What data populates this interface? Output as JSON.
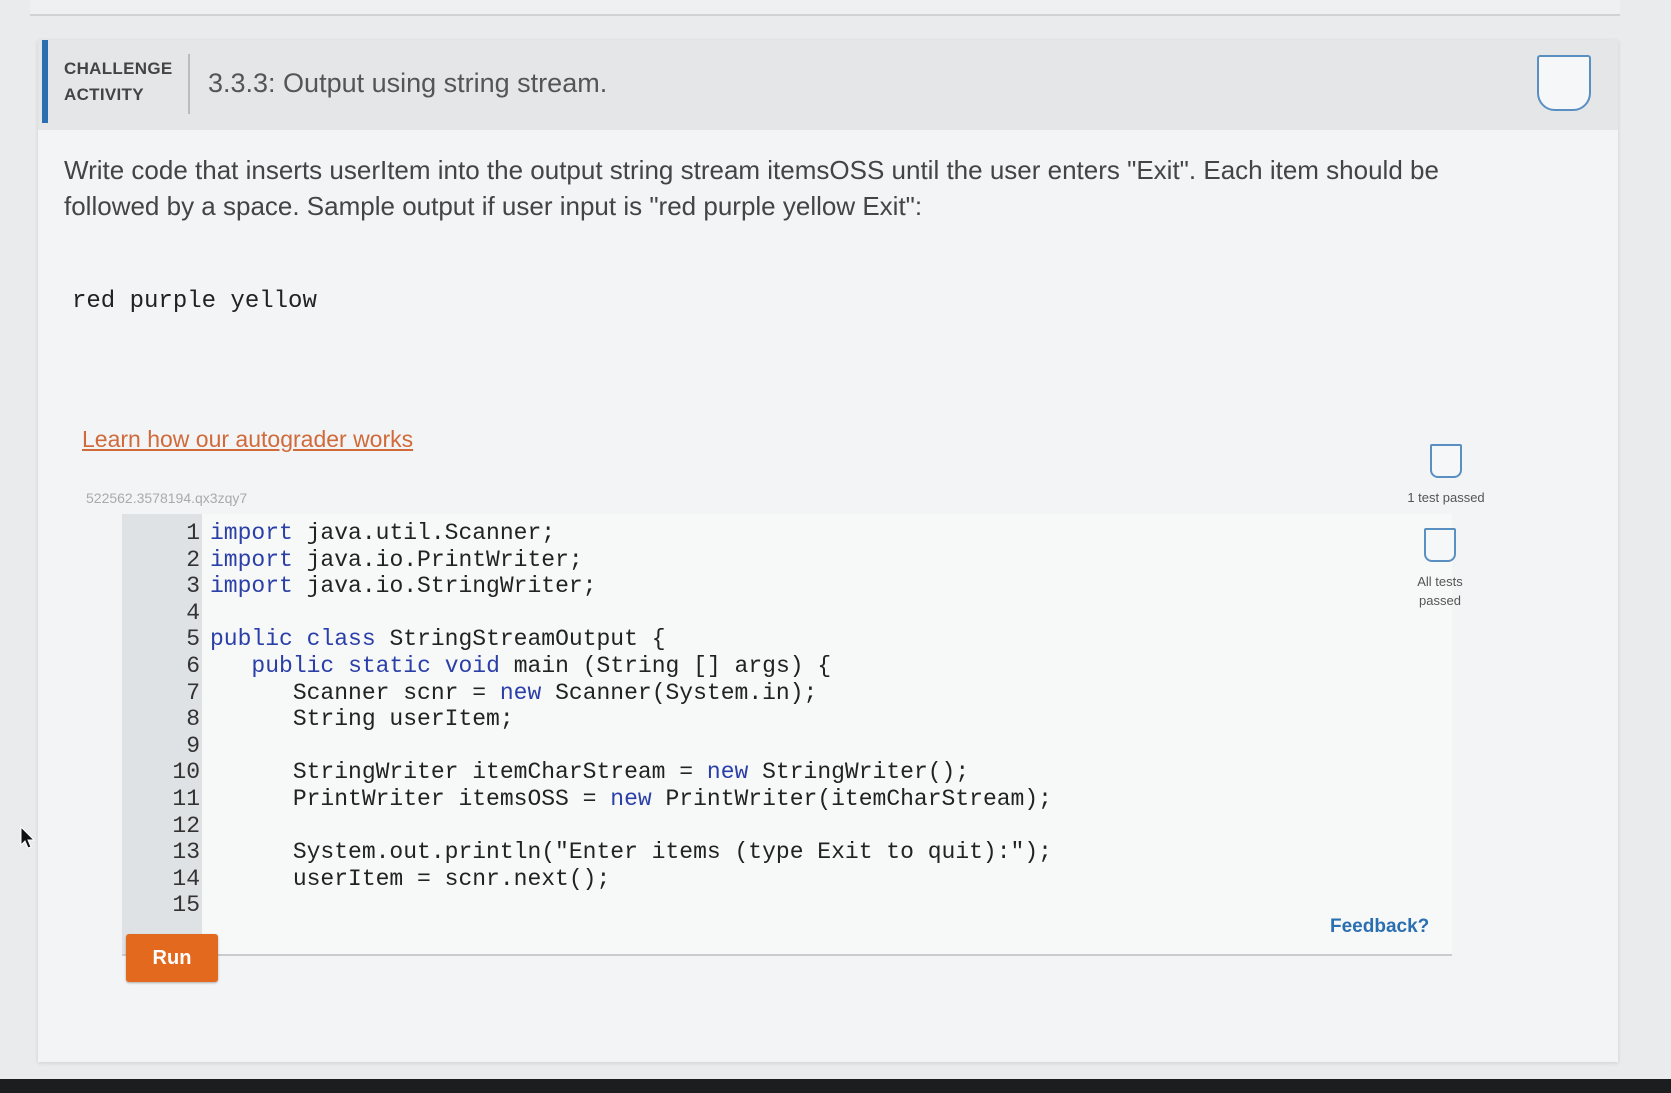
{
  "header": {
    "activity_type": "CHALLENGE ACTIVITY",
    "title": "3.3.3: Output using string stream."
  },
  "prompt": {
    "text": "Write code that inserts userItem into the output string stream itemsOSS until the user enters \"Exit\". Each item should be followed by a space. Sample output if user input is \"red purple yellow Exit\":",
    "sample_output": "red purple yellow"
  },
  "learn_link": "Learn how our autograder works",
  "activity_id": "522562.3578194.qx3zqy7",
  "code": {
    "lines": [
      {
        "num": "1",
        "text": "import java.util.Scanner;"
      },
      {
        "num": "2",
        "text": "import java.io.PrintWriter;"
      },
      {
        "num": "3",
        "text": "import java.io.StringWriter;"
      },
      {
        "num": "4",
        "text": ""
      },
      {
        "num": "5",
        "text": "public class StringStreamOutput {"
      },
      {
        "num": "6",
        "text": "   public static void main (String [] args) {"
      },
      {
        "num": "7",
        "text": "      Scanner scnr = new Scanner(System.in);"
      },
      {
        "num": "8",
        "text": "      String userItem;"
      },
      {
        "num": "9",
        "text": ""
      },
      {
        "num": "10",
        "text": "      StringWriter itemCharStream = new StringWriter();"
      },
      {
        "num": "11",
        "text": "      PrintWriter itemsOSS = new PrintWriter(itemCharStream);"
      },
      {
        "num": "12",
        "text": ""
      },
      {
        "num": "13",
        "text": "      System.out.println(\"Enter items (type Exit to quit):\");"
      },
      {
        "num": "14",
        "text": "      userItem = scnr.next();"
      },
      {
        "num": "15",
        "text": ""
      }
    ]
  },
  "run_label": "Run",
  "tests": {
    "one": "1 test passed",
    "all": "All tests passed"
  },
  "feedback_label": "Feedback?",
  "colors": {
    "accent": "#2a6fb0",
    "run": "#e3691f",
    "link": "#d06a3a",
    "keyword": "#2b3fa8"
  }
}
